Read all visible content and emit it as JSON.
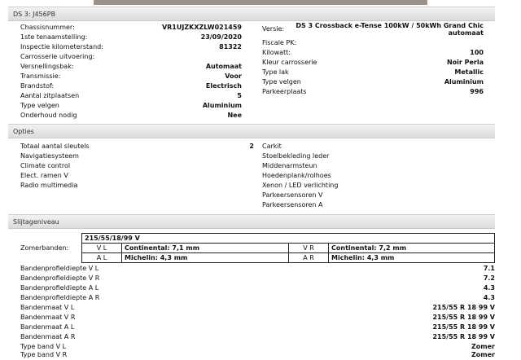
{
  "vehicle": {
    "header": "DS 3: J456PB",
    "left_fields": [
      {
        "label": "Chassisnummer:",
        "value": "VR1UJZKXZLW021459"
      },
      {
        "label": "1ste tenaamstelling:",
        "value": "23/09/2020"
      },
      {
        "label": "Inspectie kilometerstand:",
        "value": "81322"
      },
      {
        "label": "Carrosserie uitvoering:",
        "value": ""
      },
      {
        "label": "Versnellingsbak:",
        "value": "Automaat"
      },
      {
        "label": "Transmissie:",
        "value": "Voor"
      },
      {
        "label": "Brandstof:",
        "value": "Electrisch"
      },
      {
        "label": "Aantal zitplaatsen",
        "value": "5"
      },
      {
        "label": "Type velgen",
        "value": "Aluminium"
      },
      {
        "label": "Onderhoud nodig",
        "value": "Nee"
      }
    ],
    "versie": {
      "label": "Versie:",
      "value_line1": "DS 3 Crossback e-Tense 100kW / 50kWh Grand Chic",
      "value_line2": "automaat"
    },
    "right_fields": [
      {
        "label": "Fiscale PK:",
        "value": ""
      },
      {
        "label": "Kilowatt:",
        "value": "100"
      },
      {
        "label": "Kleur carrosserie",
        "value": "Noir Perla"
      },
      {
        "label": "Type lak",
        "value": "Metallic"
      },
      {
        "label": "Type velgen",
        "value": "Aluminium"
      },
      {
        "label": "Parkeerplaats",
        "value": "996"
      }
    ]
  },
  "options": {
    "header": "Opties",
    "left": [
      {
        "label": "Totaal aantal sleutels",
        "value": "2"
      },
      {
        "label": "Navigatiesysteem",
        "value": ""
      },
      {
        "label": "Climate control",
        "value": ""
      },
      {
        "label": "Elect. ramen V",
        "value": ""
      },
      {
        "label": "Radio multimedia",
        "value": ""
      }
    ],
    "right": [
      "Carkit",
      "Stoelbekleding leder",
      "Middenarmsteun",
      "Hoedenplank/rolhoes",
      "Xenon / LED verlichting",
      "Parkeersensoren V",
      "Parkeersensoren A"
    ]
  },
  "wear": {
    "header": "Slijtageniveau",
    "tyre_size": "215/55/18/99 V",
    "summer_label": "Zomerbanden:",
    "cells": {
      "vl": {
        "pos": "V L",
        "brand": "Continental: 7,1 mm"
      },
      "vr": {
        "pos": "V R",
        "brand": "Continental: 7,2 mm"
      },
      "al": {
        "pos": "A L",
        "brand": "Michelin: 4,3 mm"
      },
      "ar": {
        "pos": "A R",
        "brand": "Michelin: 4,3 mm"
      }
    },
    "rows": [
      {
        "label": "Bandenprofieldiepte V L",
        "value": "7.1"
      },
      {
        "label": "Bandenprofieldiepte V R",
        "value": "7.2"
      },
      {
        "label": "Bandenprofieldiepte A L",
        "value": "4.3"
      },
      {
        "label": "Bandenprofieldiepte A R",
        "value": "4.3"
      },
      {
        "label": "Bandenmaat V L",
        "value": "215/55 R 18 99 V"
      },
      {
        "label": "Bandenmaat V R",
        "value": "215/55 R 18 99 V"
      },
      {
        "label": "Bandenmaat A L",
        "value": "215/55 R 18 99 V"
      },
      {
        "label": "Bandenmaat A R",
        "value": "215/55 R 18 99 V"
      },
      {
        "label": "Type band V L",
        "value": "Zomer"
      },
      {
        "label": "Type band V R",
        "value": "Zomer"
      }
    ]
  }
}
